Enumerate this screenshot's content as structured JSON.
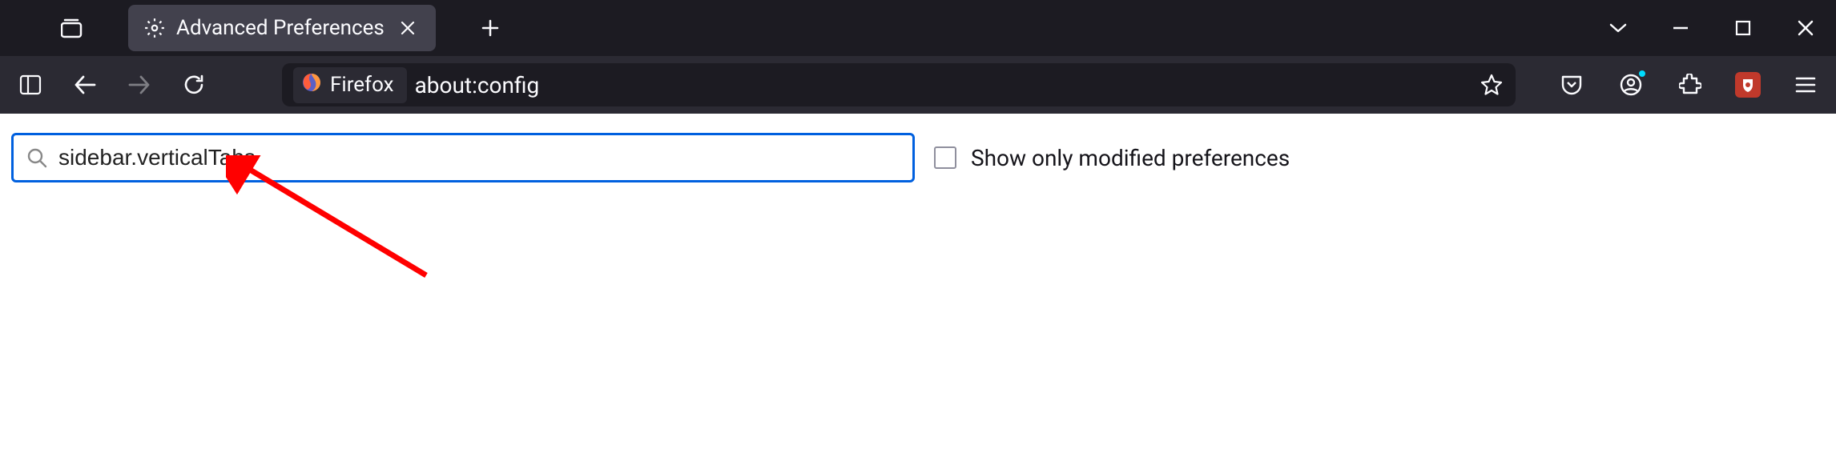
{
  "tab": {
    "title": "Advanced Preferences"
  },
  "urlbar": {
    "badge_label": "Firefox",
    "url": "about:config"
  },
  "search": {
    "value": "sidebar.verticalTabs"
  },
  "filter": {
    "checkbox_label": "Show only modified preferences"
  }
}
